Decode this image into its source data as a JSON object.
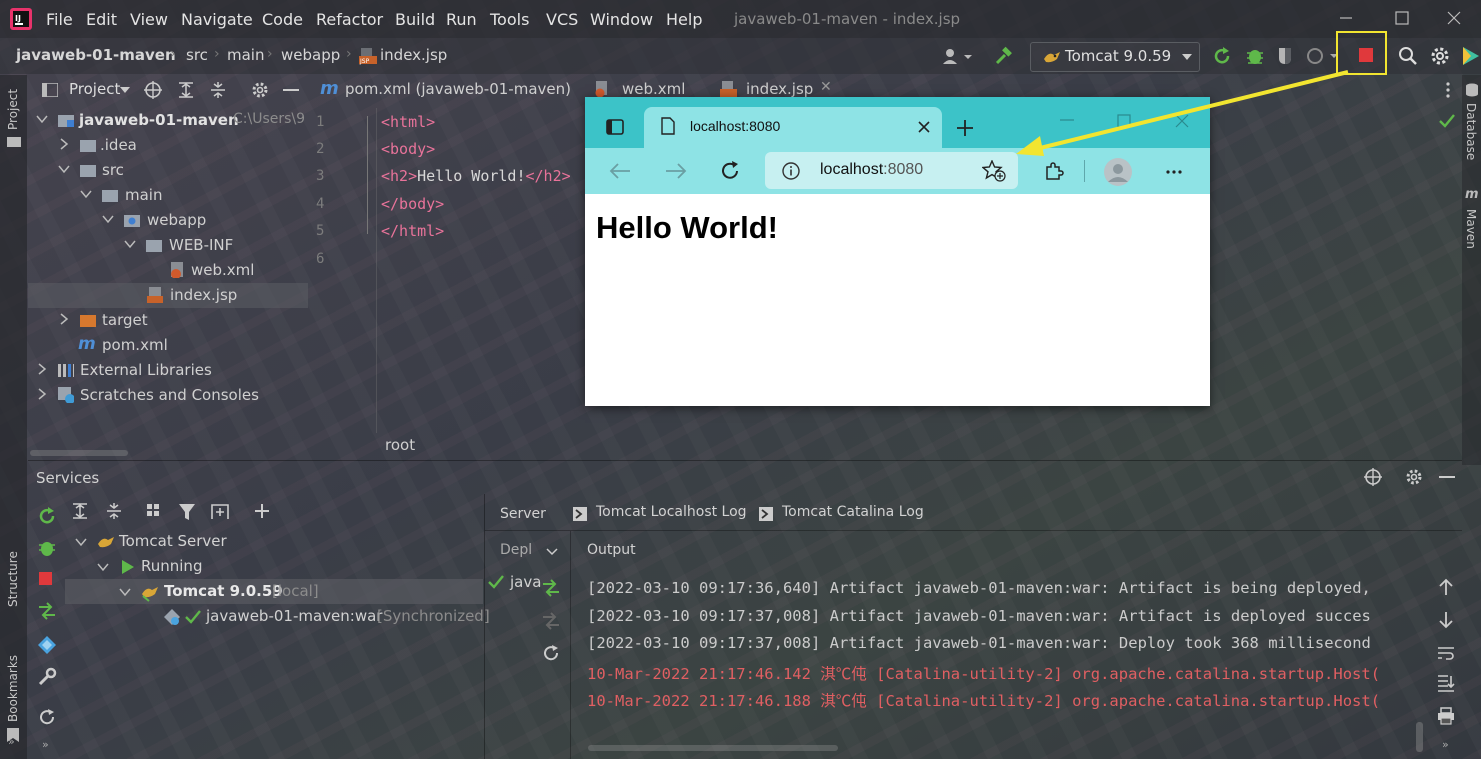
{
  "menu": {
    "items": [
      "File",
      "Edit",
      "View",
      "Navigate",
      "Code",
      "Refactor",
      "Build",
      "Run",
      "Tools",
      "VCS",
      "Window",
      "Help"
    ],
    "window_title": "javaweb-01-maven - index.jsp"
  },
  "breadcrumb": [
    "javaweb-01-maven",
    "src",
    "main",
    "webapp",
    "index.jsp"
  ],
  "run_config": {
    "label": "Tomcat 9.0.59"
  },
  "project_panel": {
    "title": "Project",
    "tree": [
      {
        "label": "javaweb-01-maven",
        "suffix": "C:\\Users\\9"
      },
      {
        "label": ".idea"
      },
      {
        "label": "src"
      },
      {
        "label": "main"
      },
      {
        "label": "webapp"
      },
      {
        "label": "WEB-INF"
      },
      {
        "label": "web.xml"
      },
      {
        "label": "index.jsp"
      },
      {
        "label": "target"
      },
      {
        "label": "pom.xml"
      },
      {
        "label": "External Libraries"
      },
      {
        "label": "Scratches and Consoles"
      }
    ]
  },
  "side_tools": {
    "left_top": "Project",
    "left_mid": "Structure",
    "left_bottom": "Bookmarks",
    "right_top": "Database",
    "right_mid": "Maven"
  },
  "editor": {
    "tabs": [
      "pom.xml (javaweb-01-maven)",
      "web.xml",
      "index.jsp"
    ],
    "line_numbers": [
      "1",
      "2",
      "3",
      "4",
      "5",
      "6"
    ],
    "code": [
      "<html>",
      "<body>",
      "<h2>",
      "Hello World!",
      "</h2>",
      "</body>",
      "</html>"
    ],
    "breadcrumb_footer": "root"
  },
  "browser": {
    "tab_title": "localhost:8080",
    "url": "localhost:8080",
    "url_host": "localhost",
    "url_port": ":8080",
    "heading": "Hello World!"
  },
  "services": {
    "title": "Services",
    "tree": {
      "server": "Tomcat Server",
      "status": "Running",
      "instance": "Tomcat 9.0.59",
      "instance_suffix": "[local]",
      "artifact": "javaweb-01-maven:war",
      "artifact_suffix": "[Synchronized]"
    },
    "tabs": [
      "Server",
      "Tomcat Localhost Log",
      "Tomcat Catalina Log"
    ],
    "deploy_header": "Depl",
    "deploy_item": "java",
    "output_header": "Output",
    "log_lines": [
      {
        "text": "[2022-03-10 09:17:36,640] Artifact javaweb-01-maven:war: Artifact is being deployed,",
        "level": "info"
      },
      {
        "text": "[2022-03-10 09:17:37,008] Artifact javaweb-01-maven:war: Artifact is deployed succes",
        "level": "info"
      },
      {
        "text": "[2022-03-10 09:17:37,008] Artifact javaweb-01-maven:war: Deploy took 368 millisecond",
        "level": "info"
      },
      {
        "text": "10-Mar-2022 21:17:46.142 淇℃伅 [Catalina-utility-2] org.apache.catalina.startup.Host(",
        "level": "error"
      },
      {
        "text": "10-Mar-2022 21:17:46.188 淇℃伅 [Catalina-utility-2] org.apache.catalina.startup.Host(",
        "level": "error"
      }
    ]
  },
  "colors": {
    "annotation_yellow": "#f2e530",
    "browser_tab_strip": "#3cc3c8",
    "browser_toolbar": "#8ee3e5",
    "stop_red": "#e0393c",
    "run_green": "#5fb84a",
    "tag_pink": "#e8739a",
    "log_red": "#e05f62"
  }
}
